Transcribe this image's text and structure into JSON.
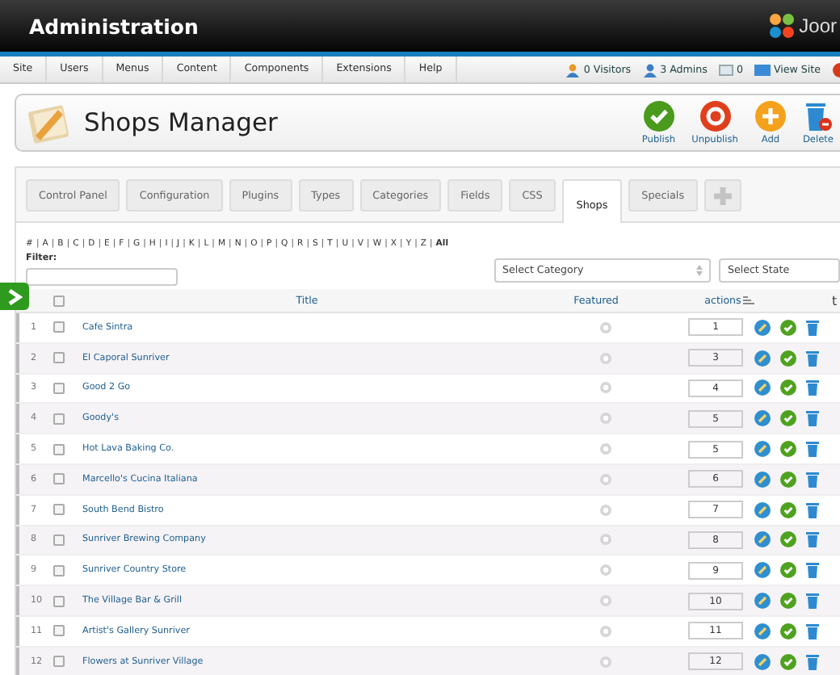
{
  "header": {
    "title": "Administration",
    "logo_text": "Joor"
  },
  "menu": {
    "items": [
      "Site",
      "Users",
      "Menus",
      "Content",
      "Components",
      "Extensions",
      "Help"
    ],
    "status": [
      {
        "kind": "visitors",
        "label": "0 Visitors"
      },
      {
        "kind": "admins",
        "label": "3 Admins"
      },
      {
        "kind": "messages",
        "label": "0"
      },
      {
        "kind": "view",
        "label": "View Site"
      }
    ]
  },
  "toolbar": {
    "title": "Shops Manager",
    "buttons": [
      {
        "kind": "publish",
        "label": "Publish"
      },
      {
        "kind": "unpublish",
        "label": "Unpublish"
      },
      {
        "kind": "add",
        "label": "Add"
      },
      {
        "kind": "delete",
        "label": "Delete"
      }
    ]
  },
  "tabs": [
    {
      "label": "Control Panel",
      "selected": false
    },
    {
      "label": "Configuration",
      "selected": false
    },
    {
      "label": "Plugins",
      "selected": false
    },
    {
      "label": "Types",
      "selected": false
    },
    {
      "label": "Categories",
      "selected": false
    },
    {
      "label": "Fields",
      "selected": false
    },
    {
      "label": "CSS",
      "selected": false
    },
    {
      "label": "Shops",
      "selected": true
    },
    {
      "label": "Specials",
      "selected": false
    }
  ],
  "letters": {
    "separator": "|",
    "items": [
      "#",
      "A",
      "B",
      "C",
      "D",
      "E",
      "F",
      "G",
      "H",
      "I",
      "J",
      "K",
      "L",
      "M",
      "N",
      "O",
      "P",
      "Q",
      "R",
      "S",
      "T",
      "U",
      "V",
      "W",
      "X",
      "Y",
      "Z",
      "All"
    ]
  },
  "filter": {
    "label": "Filter:"
  },
  "selects": [
    {
      "value": "Select Category"
    },
    {
      "value": "Select State"
    }
  ],
  "table": {
    "select_all_checked": false,
    "columns": {
      "title": "Title",
      "featured": "Featured",
      "actions": "actions",
      "column_5": "t"
    },
    "rows": [
      {
        "number": "1",
        "checked": false,
        "title": "Cafe Sintra",
        "featured": false,
        "order": "1",
        "published": true
      },
      {
        "number": "2",
        "checked": false,
        "title": "El Caporal Sunriver",
        "featured": false,
        "order": "3",
        "published": true
      },
      {
        "number": "3",
        "checked": false,
        "title": "Good 2 Go",
        "featured": false,
        "order": "4",
        "published": true
      },
      {
        "number": "4",
        "checked": false,
        "title": "Goody's",
        "featured": false,
        "order": "5",
        "published": true
      },
      {
        "number": "5",
        "checked": false,
        "title": "Hot Lava Baking Co.",
        "featured": false,
        "order": "5",
        "published": true
      },
      {
        "number": "6",
        "checked": false,
        "title": "Marcello's Cucina Italiana",
        "featured": false,
        "order": "6",
        "published": true
      },
      {
        "number": "7",
        "checked": false,
        "title": "South Bend Bistro",
        "featured": false,
        "order": "7",
        "published": true
      },
      {
        "number": "8",
        "checked": false,
        "title": "Sunriver Brewing Company",
        "featured": false,
        "order": "8",
        "published": true
      },
      {
        "number": "9",
        "checked": false,
        "title": "Sunriver Country Store",
        "featured": false,
        "order": "9",
        "published": true
      },
      {
        "number": "10",
        "checked": false,
        "title": "The Village Bar & Grill",
        "featured": false,
        "order": "10",
        "published": true
      },
      {
        "number": "11",
        "checked": false,
        "title": "Artist's Gallery Sunriver",
        "featured": false,
        "order": "11",
        "published": true
      },
      {
        "number": "12",
        "checked": false,
        "title": "Flowers at Sunriver Village",
        "featured": false,
        "order": "12",
        "published": true
      }
    ]
  }
}
